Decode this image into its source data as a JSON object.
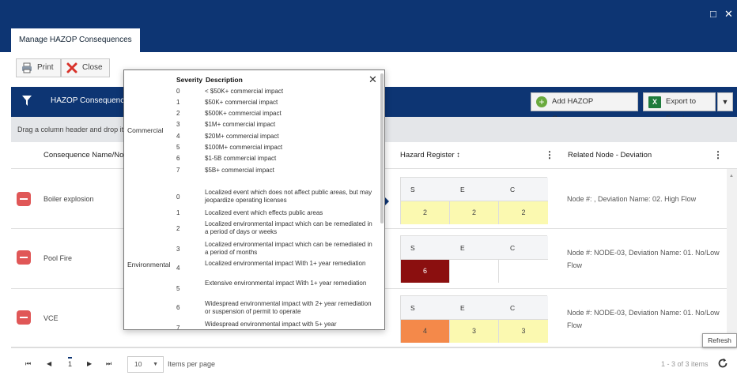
{
  "window": {
    "restore_icon": "□",
    "close_icon": "✕"
  },
  "tab": {
    "label": "Manage HAZOP Consequences"
  },
  "toolbar": {
    "print_label": "Print",
    "close_label": "Close"
  },
  "panel": {
    "title": "HAZOP Consequences",
    "add_label": "Add HAZOP Consequence",
    "export_label": "Export to Excel",
    "group_hint": "Drag a column header and drop it"
  },
  "columns": {
    "name": "Consequence Name/No.",
    "hazard": "Hazard Register ↕",
    "related": "Related Node - Deviation"
  },
  "mini_headers": [
    "S",
    "E",
    "C"
  ],
  "rows": [
    {
      "name": "Boiler explosion",
      "s": "2",
      "e": "2",
      "c": "2",
      "related": "Node #: , Deviation Name: 02. High Flow",
      "s_color": "#fbf9b0",
      "e_color": "#fbf9b0",
      "c_color": "#fbf9b0"
    },
    {
      "name": "Pool Fire",
      "s": "6",
      "e": "",
      "c": "",
      "related": "Node #: NODE-03, Deviation Name: 01. No/Low Flow",
      "s_color": "#8b0f0f",
      "e_color": "#ffffff",
      "c_color": "#ffffff"
    },
    {
      "name": "VCE",
      "s": "4",
      "e": "3",
      "c": "3",
      "related": "Node #: NODE-03, Deviation Name: 01. No/Low Flow",
      "s_color": "#f4894a",
      "e_color": "#fbf9b0",
      "c_color": "#fbf9b0"
    }
  ],
  "pager": {
    "first": "⏮",
    "prev": "◀",
    "page": "1",
    "next": "▶",
    "last": "⏭",
    "page_size": "10",
    "items_per_page": "Items per page",
    "summary": "1 - 3 of 3 items",
    "refresh_tooltip": "Refresh"
  },
  "popup": {
    "severity_header": "Severity",
    "description_header": "Description",
    "commercial_label": "Commercial",
    "environmental_label": "Environmental",
    "commercial": [
      {
        "sev": "0",
        "desc": "< $50K+ commercial impact"
      },
      {
        "sev": "1",
        "desc": "$50K+ commercial impact"
      },
      {
        "sev": "2",
        "desc": "$500K+ commercial impact"
      },
      {
        "sev": "3",
        "desc": "$1M+ commercial impact"
      },
      {
        "sev": "4",
        "desc": "$20M+ commercial impact"
      },
      {
        "sev": "5",
        "desc": "$100M+ commercial impact"
      },
      {
        "sev": "6",
        "desc": "$1-5B commercial impact"
      },
      {
        "sev": "7",
        "desc": "$5B+ commercial impact"
      }
    ],
    "environmental": [
      {
        "sev": "0",
        "desc": "Localized event which does not affect public areas, but may jeopardize operating licenses"
      },
      {
        "sev": "1",
        "desc": "Localized event which effects public areas"
      },
      {
        "sev": "2",
        "desc": "Localized environmental impact which can be remediated in a period of days or weeks"
      },
      {
        "sev": "3",
        "desc": "Localized environmental impact which can be remediated in a period of months"
      },
      {
        "sev": "4",
        "desc": "Localized environmental impact With 1+ year remediation"
      },
      {
        "sev": "5",
        "desc": "Extensive environmental impact With 1+ year remediation"
      },
      {
        "sev": "6",
        "desc": "Widespread environmental impact with 2+ year remediation or suspension of permit to operate"
      },
      {
        "sev": "7",
        "desc": "Widespread environmental impact with 5+ year"
      }
    ]
  }
}
